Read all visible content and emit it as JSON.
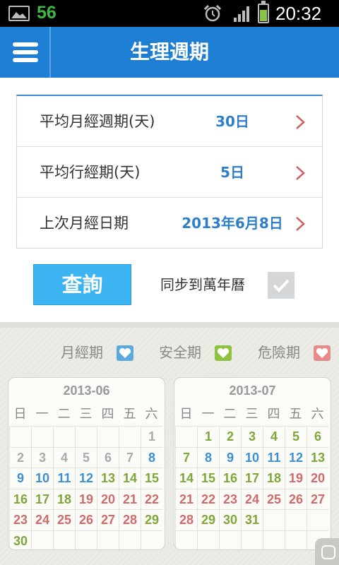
{
  "status_bar": {
    "notification_count": "56",
    "time": "20:32"
  },
  "header": {
    "title": "生理週期"
  },
  "settings": [
    {
      "label": "平均月經週期(天)",
      "value": "30日"
    },
    {
      "label": "平均行經期(天)",
      "value": "5日"
    },
    {
      "label": "上次月經日期",
      "value": "2013年6月8日"
    }
  ],
  "actions": {
    "query_label": "查詢",
    "sync_label": "同步到萬年曆",
    "sync_checked": true
  },
  "legend": [
    {
      "label": "月經期",
      "color": "#5aa9dd"
    },
    {
      "label": "安全期",
      "color": "#8fc23f"
    },
    {
      "label": "危險期",
      "color": "#e98a8a"
    }
  ],
  "weekdays": [
    "日",
    "一",
    "二",
    "三",
    "四",
    "五",
    "六"
  ],
  "calendars": [
    {
      "title": "2013-06",
      "first_weekday": 6,
      "days": 30,
      "day_types": [
        "s",
        "s",
        "s",
        "s",
        "s",
        "s",
        "s",
        "p",
        "p",
        "p",
        "p",
        "p",
        "s",
        "s",
        "s",
        "s",
        "s",
        "s",
        "d",
        "d",
        "d",
        "d",
        "d",
        "d",
        "d",
        "d",
        "d",
        "d",
        "s",
        "s"
      ]
    },
    {
      "title": "2013-07",
      "first_weekday": 1,
      "days": 31,
      "day_types": [
        "s",
        "s",
        "s",
        "s",
        "s",
        "s",
        "s",
        "p",
        "p",
        "p",
        "p",
        "p",
        "s",
        "s",
        "s",
        "s",
        "s",
        "s",
        "d",
        "d",
        "d",
        "d",
        "d",
        "d",
        "d",
        "d",
        "d",
        "d",
        "s",
        "s",
        "s"
      ]
    }
  ],
  "colors": {
    "header": "#1e7ed3",
    "query_button": "#3db4f2",
    "value_text": "#2d7fc8"
  }
}
